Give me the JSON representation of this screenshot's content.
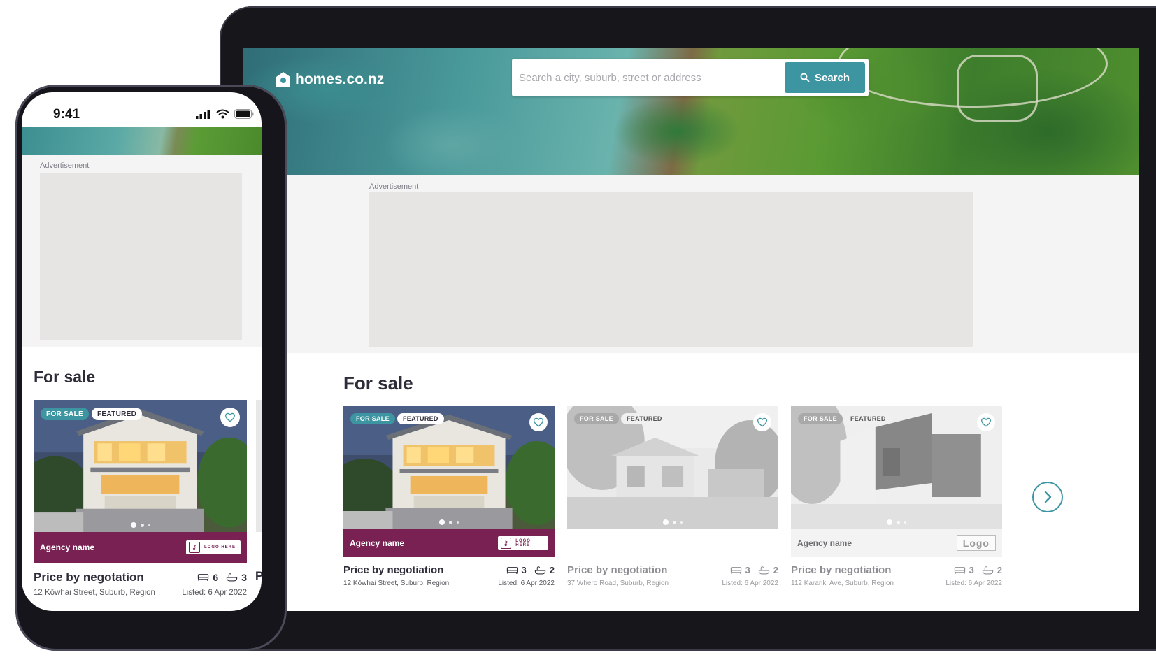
{
  "tablet": {
    "brand": "homes.co.nz",
    "search": {
      "placeholder": "Search a city, suburb, street or address",
      "button": "Search"
    },
    "ad_label": "Advertisement",
    "section_title": "For sale",
    "cards": [
      {
        "badge_sale": "FOR SALE",
        "badge_featured": "FEATURED",
        "agency": "Agency name",
        "agency_logo": "LOGO HERE",
        "price": "Price by negotiation",
        "beds": "3",
        "baths": "2",
        "address": "12 Kōwhai Street, Suburb, Region",
        "listed": "Listed: 6 Apr 2022",
        "active": true
      },
      {
        "badge_sale": "FOR SALE",
        "badge_featured": "FEATURED",
        "agency": "",
        "agency_logo": "",
        "price": "Price by negotiation",
        "beds": "3",
        "baths": "2",
        "address": "37 Whero Road, Suburb, Region",
        "listed": "Listed: 6 Apr 2022",
        "active": false
      },
      {
        "badge_sale": "FOR SALE",
        "badge_featured": "FEATURED",
        "agency": "Agency name",
        "agency_logo": "Logo",
        "price": "Price by negotiation",
        "beds": "3",
        "baths": "2",
        "address": "112 Karariki Ave, Suburb, Region",
        "listed": "Listed: 6 Apr 2022",
        "active": false
      }
    ]
  },
  "phone": {
    "time": "9:41",
    "ad_label": "Advertisement",
    "section_title": "For sale",
    "card": {
      "badge_sale": "FOR SALE",
      "badge_featured": "FEATURED",
      "agency": "Agency name",
      "agency_logo": "LOGO HERE",
      "price": "Price by negotation",
      "beds": "6",
      "baths": "3",
      "address": "12 Kōwhai Street, Suburb, Region",
      "listed": "Listed: 6 Apr 2022"
    },
    "next_card_peek": "P"
  },
  "colors": {
    "accent": "#3c95a1",
    "agency_purple": "#7a2153",
    "ad_placeholder": "#e6e5e3",
    "heading": "#2d2d3a"
  },
  "icons": [
    "house-logo-icon",
    "search-icon",
    "heart-icon",
    "bed-icon",
    "bath-icon",
    "key-icon",
    "chevron-right-icon",
    "signal-icon",
    "wifi-icon",
    "battery-icon"
  ]
}
